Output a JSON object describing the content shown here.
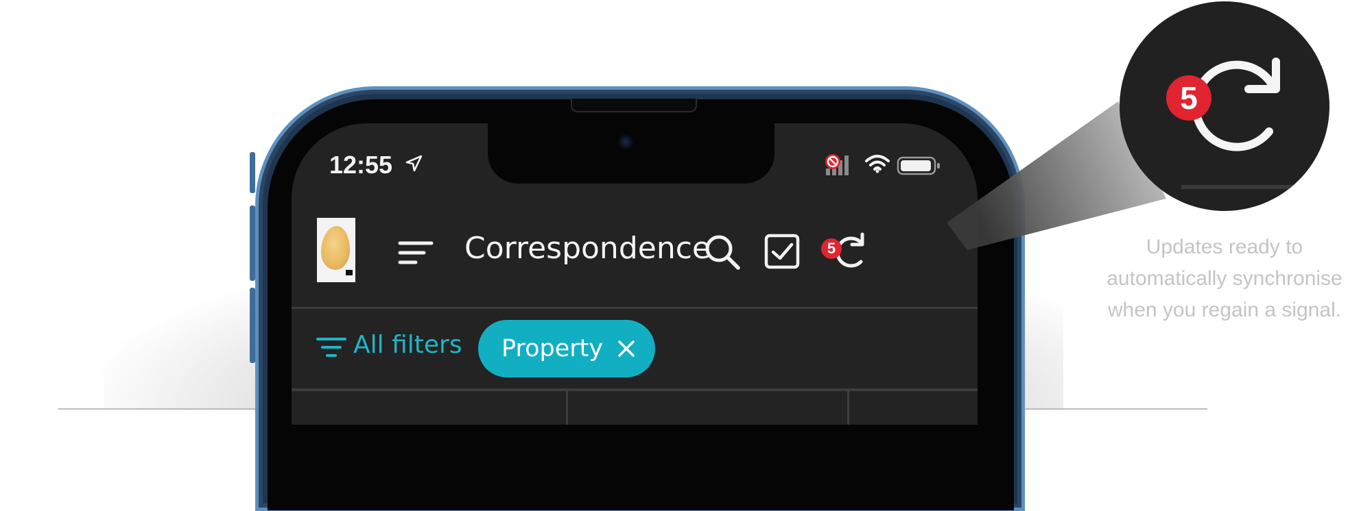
{
  "status_bar": {
    "time": "12:55"
  },
  "header": {
    "title": "Correspondence",
    "sync_pending_count": "5"
  },
  "filters": {
    "all_filters_label": "All filters",
    "active_chip_label": "Property"
  },
  "callout": {
    "badge_count": "5",
    "caption_lines": [
      "Updates ready to",
      "automatically synchronise",
      "when you regain a signal."
    ]
  },
  "colors": {
    "accent_teal": "#12afc2",
    "badge_red": "#e02430",
    "screen_bg": "#232323",
    "frame_blue": "#5d8fbf",
    "caption_gray": "#c4c4c4"
  },
  "icons": [
    "location-arrow-icon",
    "no-signal-icon",
    "wifi-icon",
    "battery-icon",
    "menu-icon",
    "search-icon",
    "select-checkbox-icon",
    "sync-icon",
    "filter-icon",
    "close-icon"
  ]
}
